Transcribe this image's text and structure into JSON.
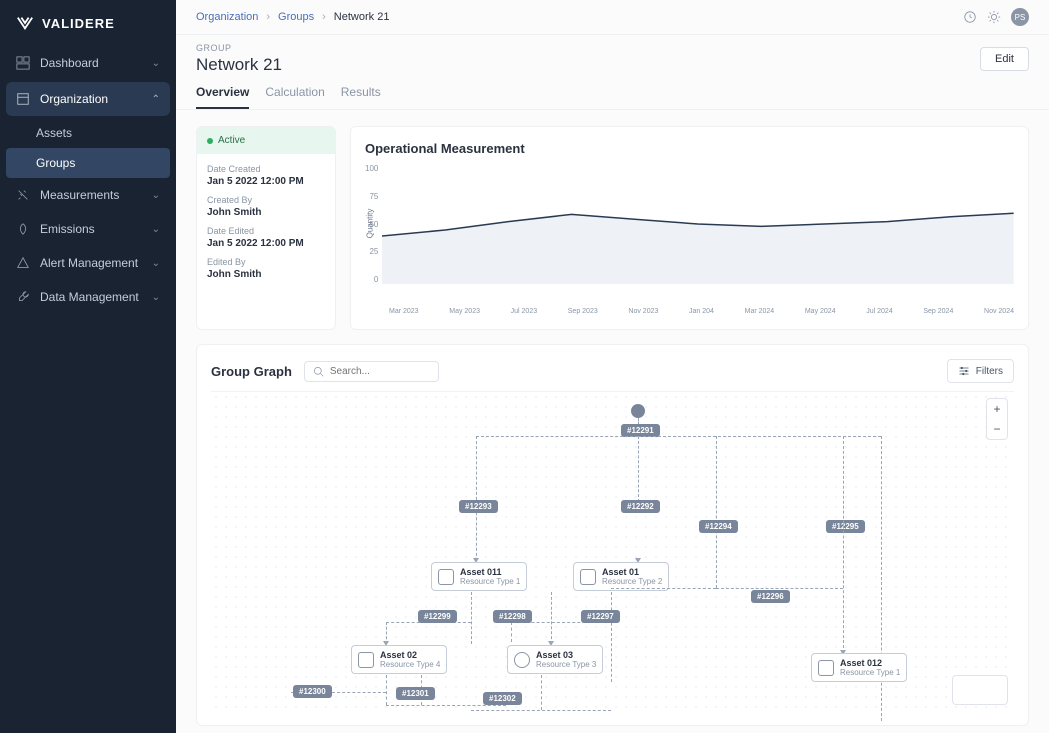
{
  "brand": "VALIDERE",
  "sidebar": {
    "items": [
      {
        "label": "Dashboard",
        "expanded": false
      },
      {
        "label": "Organization",
        "expanded": true,
        "active": true,
        "children": [
          {
            "label": "Assets"
          },
          {
            "label": "Groups",
            "active": true
          }
        ]
      },
      {
        "label": "Measurements",
        "expanded": false
      },
      {
        "label": "Emissions",
        "expanded": false
      },
      {
        "label": "Alert Management",
        "expanded": false
      },
      {
        "label": "Data Management",
        "expanded": false
      }
    ]
  },
  "breadcrumb": {
    "org": "Organization",
    "groups": "Groups",
    "current": "Network 21"
  },
  "avatar_initials": "PS",
  "header": {
    "type": "GROUP",
    "title": "Network 21",
    "edit": "Edit"
  },
  "tabs": [
    {
      "label": "Overview",
      "active": true
    },
    {
      "label": "Calculation"
    },
    {
      "label": "Results"
    }
  ],
  "info": {
    "status": "Active",
    "date_created_label": "Date Created",
    "date_created": "Jan 5 2022 12:00 PM",
    "created_by_label": "Created By",
    "created_by": "John Smith",
    "date_edited_label": "Date Edited",
    "date_edited": "Jan 5 2022 12:00 PM",
    "edited_by_label": "Edited By",
    "edited_by": "John Smith"
  },
  "chart_data": {
    "type": "line",
    "title": "Operational Measurement",
    "ylabel": "Quantity",
    "ylim": [
      0,
      100
    ],
    "yticks": [
      0,
      25,
      50,
      75,
      100
    ],
    "categories": [
      "Mar 2023",
      "May 2023",
      "Jul 2023",
      "Sep 2023",
      "Nov 2023",
      "Jan 204",
      "Mar 2024",
      "May 2024",
      "Jul 2024",
      "Sep 2024",
      "Nov 2024"
    ],
    "values": [
      40,
      45,
      52,
      58,
      54,
      50,
      48,
      50,
      52,
      56,
      59
    ]
  },
  "graph": {
    "title": "Group Graph",
    "search_placeholder": "Search...",
    "filters": "Filters",
    "tags": [
      "#12291",
      "#12292",
      "#12293",
      "#12294",
      "#12295",
      "#12296",
      "#12297",
      "#12298",
      "#12299",
      "#12300",
      "#12301",
      "#12302"
    ],
    "assets": [
      {
        "name": "Asset 011",
        "type": "Resource Type 1"
      },
      {
        "name": "Asset 01",
        "type": "Resource Type 2"
      },
      {
        "name": "Asset 02",
        "type": "Resource Type 4"
      },
      {
        "name": "Asset 03",
        "type": "Resource Type 3"
      },
      {
        "name": "Asset 012",
        "type": "Resource Type 1"
      }
    ]
  }
}
